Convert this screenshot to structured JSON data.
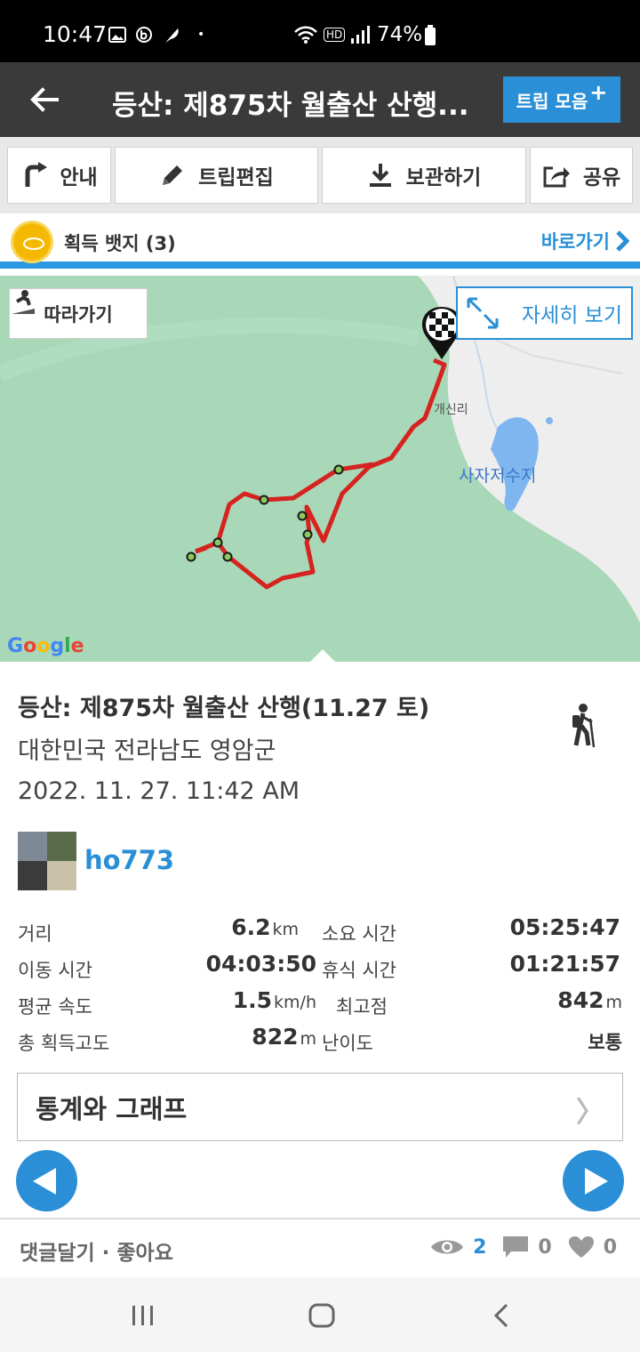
{
  "status_bar": {
    "time": "10:47",
    "dot": "•",
    "battery": "74%",
    "hd": "HD"
  },
  "header": {
    "title": "등산: 제875차 월출산 산행...",
    "trip_button": "트립 모음",
    "trip_button_plus": "+"
  },
  "toolbar": {
    "guide": "안내",
    "edit": "트립편집",
    "save": "보관하기",
    "share": "공유"
  },
  "badge": {
    "label": "획득 뱃지 (3)",
    "goto": "바로가기"
  },
  "map": {
    "follow": "따라가기",
    "detail": "자세히 보기",
    "village_label": "개신리",
    "lake_label": "사자저수지",
    "google": [
      "G",
      "o",
      "o",
      "g",
      "l",
      "e"
    ],
    "google_colors": [
      "#4285F4",
      "#EA4335",
      "#FBBC05",
      "#4285F4",
      "#34A853",
      "#EA4335"
    ],
    "route_color": "#d6231f"
  },
  "trip": {
    "title": "등산: 제875차 월출산 산행(11.27 토)",
    "location": "대한민국 전라남도 영암군",
    "date": "2022. 11. 27. 11:42 AM",
    "username": "ho773"
  },
  "stats": {
    "distance_label": "거리",
    "distance_value": "6.2",
    "distance_unit": "km",
    "total_time_label": "소요 시간",
    "total_time_value": "05:25:47",
    "moving_time_label": "이동 시간",
    "moving_time_value": "04:03:50",
    "rest_time_label": "휴식 시간",
    "rest_time_value": "01:21:57",
    "avg_speed_label": "평균 속도",
    "avg_speed_value": "1.5",
    "avg_speed_unit": "km/h",
    "max_alt_label": "최고점",
    "max_alt_value": "842",
    "max_alt_unit": "m",
    "elev_gain_label": "총 획득고도",
    "elev_gain_value": "822",
    "elev_gain_unit": "m",
    "difficulty_label": "난이도",
    "difficulty_value": "보통"
  },
  "stats_button": "통계와 그래프",
  "stats_button_chevron": "〉",
  "bottom": {
    "comment_like": "댓글달기 · 좋아요",
    "views": "2",
    "comments": "0",
    "likes": "0"
  },
  "colors": {
    "accent": "#2a8fd6",
    "header_bg": "#3a3a3a",
    "map_green": "#a8d8b8"
  }
}
